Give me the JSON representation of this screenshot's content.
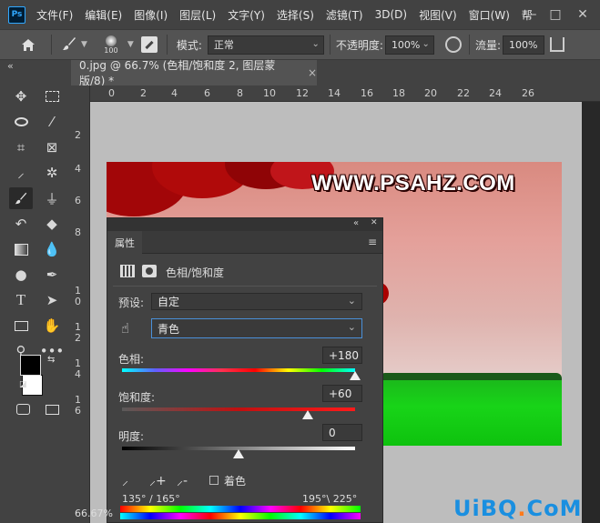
{
  "app": {
    "logo": "Ps"
  },
  "menu": [
    "文件(F)",
    "编辑(E)",
    "图像(I)",
    "图层(L)",
    "文字(Y)",
    "选择(S)",
    "滤镜(T)",
    "3D(D)",
    "视图(V)",
    "窗口(W)",
    "帮"
  ],
  "window_controls": {
    "minimize": "–",
    "maximize": "□",
    "close": "✕"
  },
  "options_bar": {
    "brush_size": "100",
    "mode_label": "模式:",
    "mode_value": "正常",
    "opacity_label": "不透明度:",
    "opacity_value": "100%",
    "flow_label": "流量:",
    "flow_value": "100%"
  },
  "panel_collapse": "«",
  "doc_tab": {
    "title": "0.jpg @ 66.7% (色相/饱和度 2, 图层蒙版/8) *",
    "close": "×"
  },
  "ruler_top": [
    "0",
    "2",
    "4",
    "6",
    "8",
    "10",
    "12",
    "14",
    "16",
    "18",
    "20",
    "22",
    "24",
    "26"
  ],
  "ruler_left": [
    "2",
    "4",
    "6",
    "8",
    "1\n0",
    "1\n2",
    "1\n4",
    "1\n6"
  ],
  "watermark": "WWW.PSAHZ.COM",
  "properties": {
    "tab_label": "属性",
    "adj_title": "色相/饱和度",
    "preset_label": "预设:",
    "preset_value": "自定",
    "channel_value": "青色",
    "hue_label": "色相:",
    "hue_value": "+180",
    "hue_level": 1.0,
    "saturation_label": "饱和度:",
    "saturation_value": "+60",
    "saturation_level": 0.8,
    "lightness_label": "明度:",
    "lightness_value": "0",
    "lightness_level": 0.5,
    "colorize_label": "着色",
    "range_left": "135° / 165°",
    "range_right": "195°\\ 225°",
    "collapse": "«",
    "close": "✕",
    "menu": "≡"
  },
  "status": {
    "zoom": "66.67%"
  },
  "site_watermark": {
    "part1": "UiBQ",
    "dot": ".",
    "part2": "CoM"
  },
  "colors": {
    "accent": "#31a8ff",
    "panel": "#424242",
    "grass": "#18d418",
    "tree": "#a20608"
  },
  "icons": [
    "home-icon",
    "brush-icon",
    "brush-settings-icon",
    "airbrush-icon",
    "pressure-icon",
    "share-icon",
    "move-icon",
    "marquee-icon",
    "lasso-icon",
    "magic-wand-icon",
    "crop-icon",
    "frame-icon",
    "eyedropper-icon",
    "patch-icon",
    "brush-tool-icon",
    "stamp-icon",
    "history-brush-icon",
    "eraser-icon",
    "gradient-icon",
    "blur-icon",
    "dodge-icon",
    "pen-icon",
    "type-icon",
    "path-select-icon",
    "rectangle-icon",
    "hand-icon",
    "zoom-icon",
    "more-icon",
    "foreground-color",
    "background-color",
    "quick-mask-icon",
    "screen-mode-icon",
    "targeted-adjust-icon",
    "sample-eyedropper-icon",
    "add-sample-icon",
    "subtract-sample-icon"
  ]
}
